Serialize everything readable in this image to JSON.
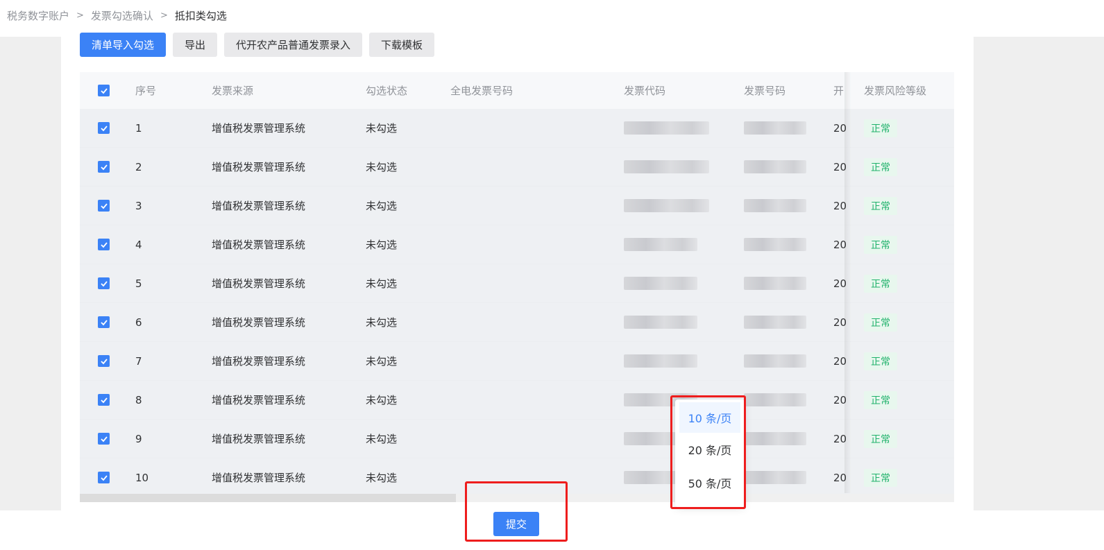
{
  "breadcrumb": [
    "税务数字账户",
    "发票勾选确认",
    "抵扣类勾选"
  ],
  "toolbar": {
    "import_label": "清单导入勾选",
    "export_label": "导出",
    "agri_label": "代开农产品普通发票录入",
    "template_label": "下载模板"
  },
  "table": {
    "headers": {
      "index": "序号",
      "source": "发票来源",
      "status": "勾选状态",
      "full_number": "全电发票号码",
      "code": "发票代码",
      "number": "发票号码",
      "date": "开",
      "risk": "发票风险等级"
    },
    "rows": [
      {
        "index": "1",
        "source": "增值税发票管理系统",
        "status": "未勾选",
        "date": "20",
        "risk": "正常"
      },
      {
        "index": "2",
        "source": "增值税发票管理系统",
        "status": "未勾选",
        "date": "20",
        "risk": "正常"
      },
      {
        "index": "3",
        "source": "增值税发票管理系统",
        "status": "未勾选",
        "date": "20",
        "risk": "正常"
      },
      {
        "index": "4",
        "source": "增值税发票管理系统",
        "status": "未勾选",
        "date": "20",
        "risk": "正常"
      },
      {
        "index": "5",
        "source": "增值税发票管理系统",
        "status": "未勾选",
        "date": "20",
        "risk": "正常"
      },
      {
        "index": "6",
        "source": "增值税发票管理系统",
        "status": "未勾选",
        "date": "20",
        "risk": "正常"
      },
      {
        "index": "7",
        "source": "增值税发票管理系统",
        "status": "未勾选",
        "date": "20",
        "risk": "正常"
      },
      {
        "index": "8",
        "source": "增值税发票管理系统",
        "status": "未勾选",
        "date": "20",
        "risk": "正常"
      },
      {
        "index": "9",
        "source": "增值税发票管理系统",
        "status": "未勾选",
        "date": "20",
        "risk": "正常"
      },
      {
        "index": "10",
        "source": "增值税发票管理系统",
        "status": "未勾选",
        "date": "20",
        "risk": "正常"
      }
    ]
  },
  "page_size": {
    "options": [
      "10 条/页",
      "20 条/页",
      "50 条/页"
    ],
    "selected": "10 条/页"
  },
  "submit_label": "提交",
  "colors": {
    "primary": "#3b82f6",
    "risk_ok_text": "#20b26b",
    "risk_ok_bg": "#e8f7ee",
    "highlight_box": "#ee1d1d"
  }
}
